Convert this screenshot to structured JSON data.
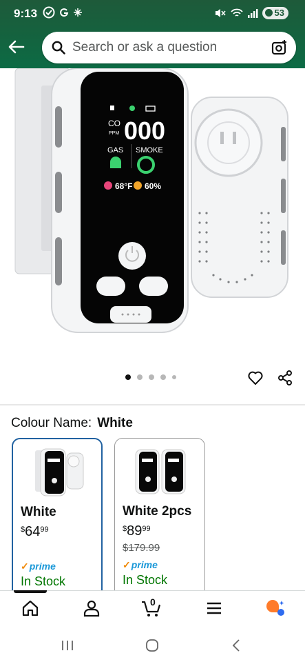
{
  "status_bar": {
    "time": "9:13",
    "battery": "53"
  },
  "header": {
    "search_placeholder": "Search or ask a question"
  },
  "product_image": {
    "display_co_label": "CO",
    "display_ppm_label": "PPM",
    "display_reading": "000",
    "display_gas_label": "GAS",
    "display_smoke_label": "SMOKE",
    "display_temp": "68°F",
    "display_humidity": "60%"
  },
  "carousel": {
    "total_images": 5,
    "active_index": 0
  },
  "colour": {
    "label": "Colour Name:",
    "value": "White"
  },
  "variants": [
    {
      "name": "White",
      "price_symbol": "$",
      "price_whole": "64",
      "price_fraction": "99",
      "list_price": "",
      "prime": "prime",
      "stock": "In Stock",
      "selected": true
    },
    {
      "name": "White 2pcs",
      "price_symbol": "$",
      "price_whole": "89",
      "price_fraction": "99",
      "list_price": "$179.99",
      "prime": "prime",
      "stock": "In Stock",
      "selected": false
    }
  ],
  "bottom_nav": {
    "cart_count": "0",
    "items": [
      "home-icon",
      "account-icon",
      "cart-icon",
      "menu-icon",
      "rufus-icon"
    ]
  },
  "colors": {
    "header_green": "#14633f",
    "selected_border": "#2162a1",
    "in_stock": "#007600",
    "prime_blue": "#1a98d8",
    "prime_check": "#f08804"
  }
}
